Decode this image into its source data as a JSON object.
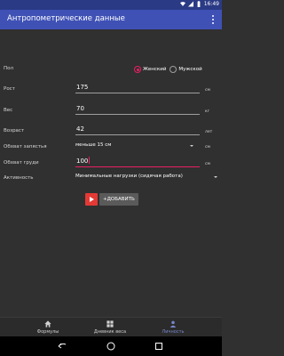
{
  "status_bar": {
    "time": "16:49"
  },
  "app_bar": {
    "title": "Антропометрические данные",
    "menu_icon": "more-vertical-icon"
  },
  "form": {
    "gender": {
      "label": "Пол",
      "options": [
        {
          "label": "Женский",
          "checked": true
        },
        {
          "label": "Мужской",
          "checked": false
        }
      ]
    },
    "height": {
      "label": "Рост",
      "value": "175",
      "unit": "см"
    },
    "weight": {
      "label": "Вес",
      "value": "70",
      "unit": "кг"
    },
    "age": {
      "label": "Возраст",
      "value": "42",
      "unit": "лет"
    },
    "wrist": {
      "label": "Обхват запястья",
      "value": "меньше 15 см",
      "unit": "см"
    },
    "chest": {
      "label": "Обхват груди",
      "value": "100",
      "unit": "см"
    },
    "activity": {
      "label": "Активность",
      "value": "Минимальные нагрузки (сидячая работа)"
    },
    "add_button_label": "+ДОБАВИТЬ"
  },
  "bottom_nav": [
    {
      "label": "Формулы",
      "icon": "home-icon",
      "active": false
    },
    {
      "label": "Дневник веса",
      "icon": "grid-icon",
      "active": false
    },
    {
      "label": "Личность",
      "icon": "person-icon",
      "active": true
    }
  ],
  "colors": {
    "primary": "#3f51b5",
    "accent": "#e91e63",
    "background": "#303030"
  }
}
